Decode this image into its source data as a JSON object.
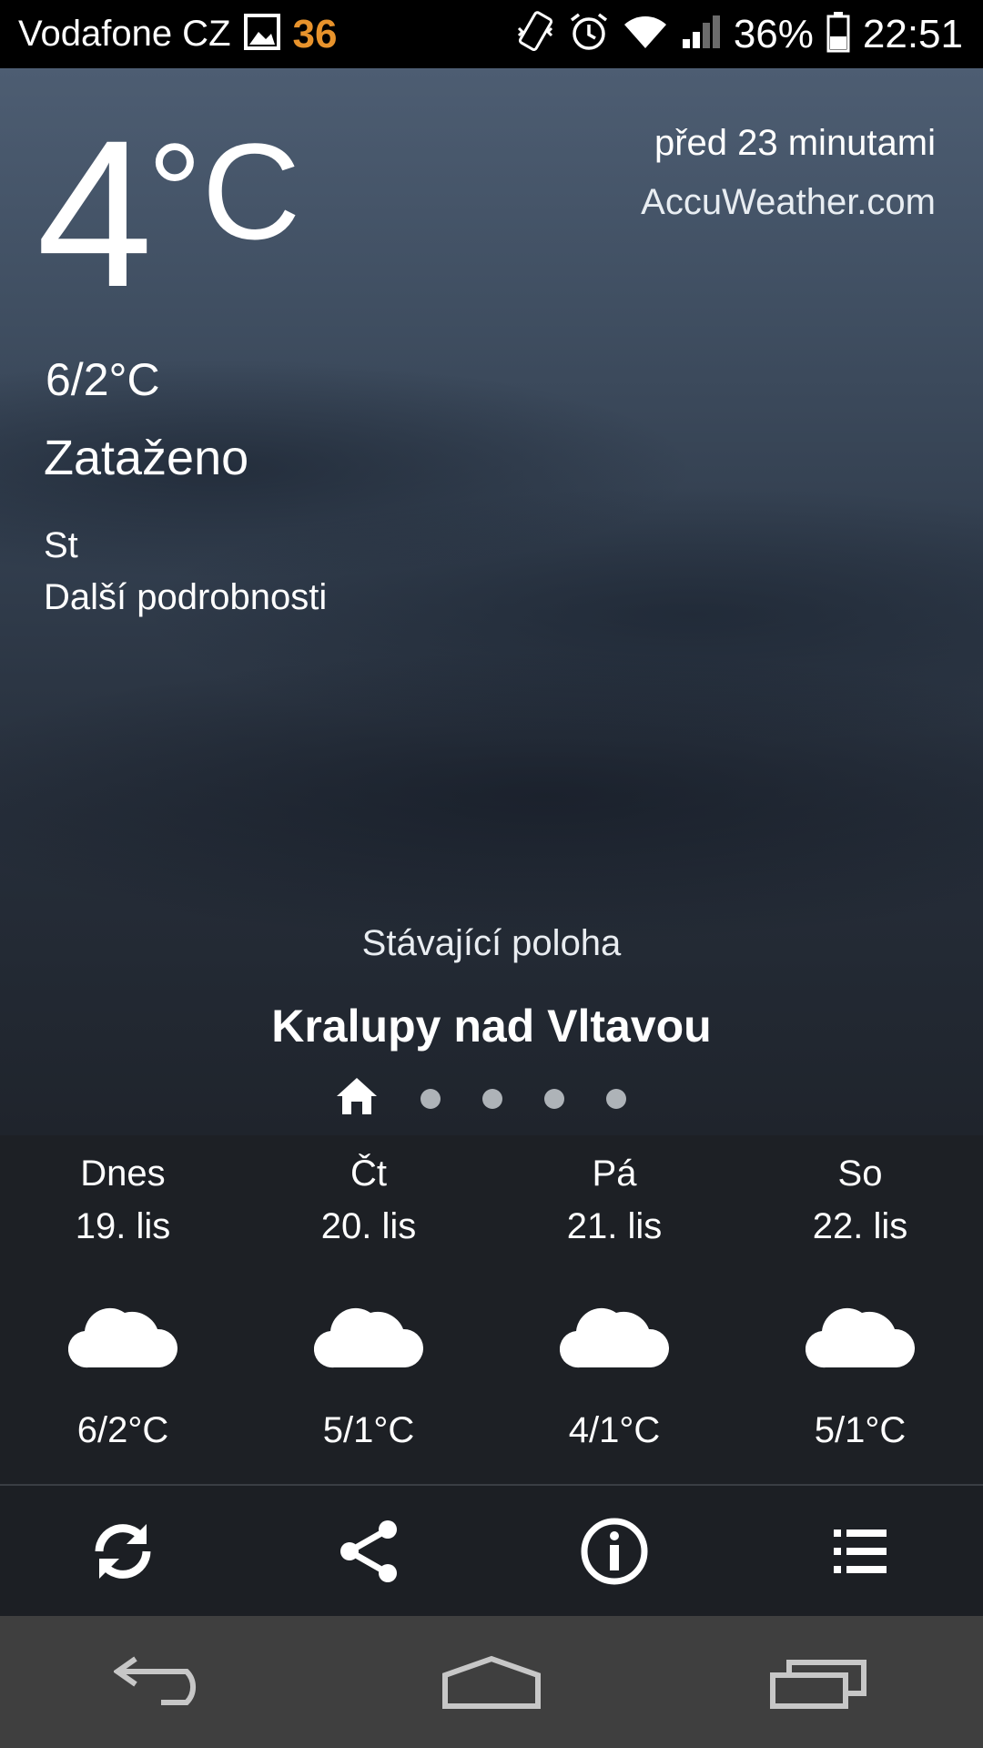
{
  "statusbar": {
    "carrier": "Vodafone CZ",
    "notification_count": "36",
    "battery": "36%",
    "time": "22:51",
    "icons": [
      "image-icon",
      "vibrate-icon",
      "alarm-icon",
      "wifi-icon",
      "signal-icon",
      "battery-icon"
    ]
  },
  "current": {
    "temp": "4",
    "unit": "°C",
    "hilo": "6/2°C",
    "condition": "Zataženo",
    "day": "St",
    "more_details": "Další podrobnosti",
    "updated": "před 23 minutami",
    "source": "AccuWeather.com"
  },
  "location": {
    "label": "Stávající poloha",
    "name": "Kralupy nad Vltavou",
    "page_count": 5
  },
  "forecast": [
    {
      "day": "Dnes",
      "date": "19. lis",
      "icon": "cloud-icon",
      "temp": "6/2°C"
    },
    {
      "day": "Čt",
      "date": "20. lis",
      "icon": "cloud-icon",
      "temp": "5/1°C"
    },
    {
      "day": "Pá",
      "date": "21. lis",
      "icon": "cloud-icon",
      "temp": "4/1°C"
    },
    {
      "day": "So",
      "date": "22. lis",
      "icon": "cloud-icon",
      "temp": "5/1°C"
    }
  ],
  "actions": [
    "refresh-icon",
    "share-icon",
    "info-icon",
    "list-icon"
  ],
  "navbar": [
    "back-icon",
    "home-icon",
    "recents-icon"
  ],
  "colors": {
    "badge": "#e8932c",
    "forecast_bg": "#1d2025",
    "navbar_bg": "#3f3f3f"
  }
}
